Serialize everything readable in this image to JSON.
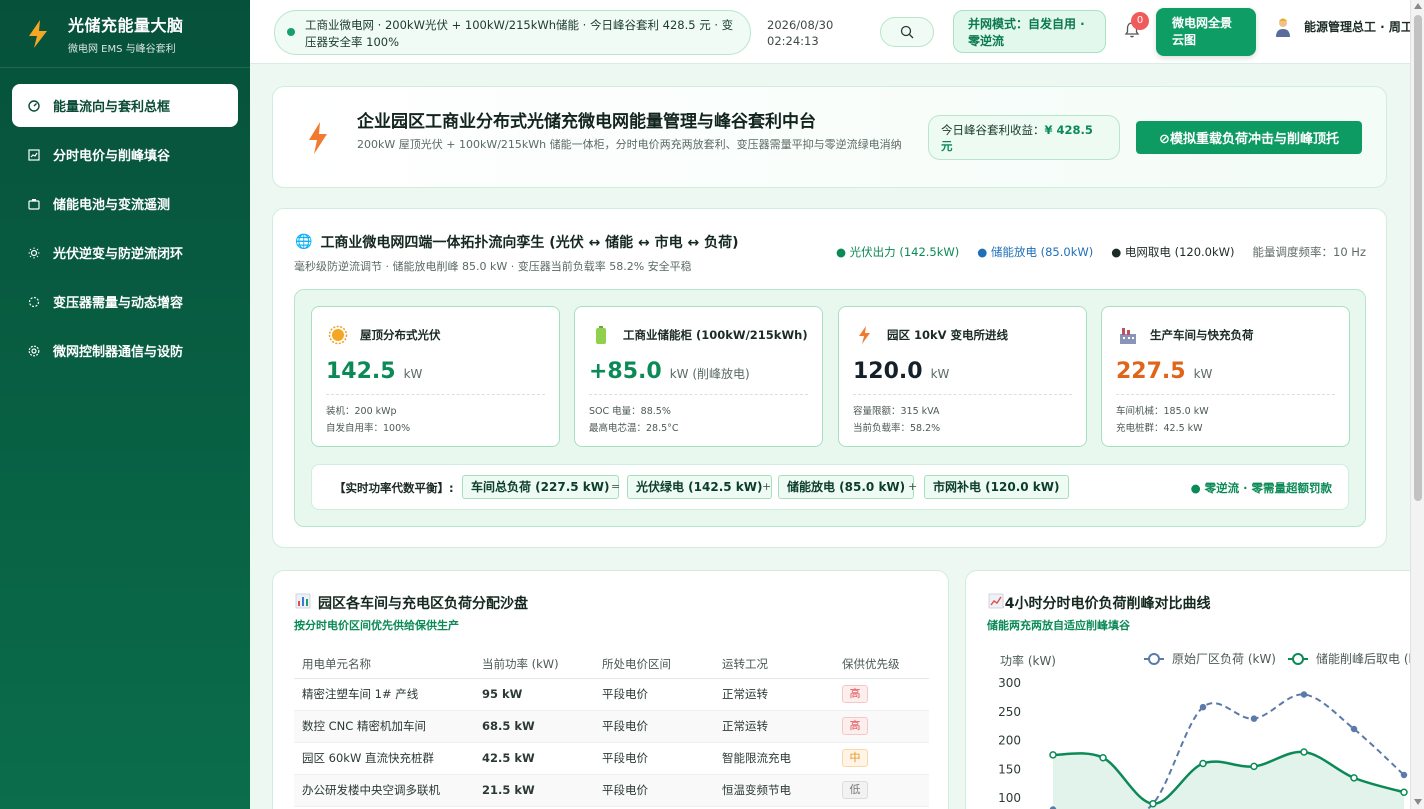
{
  "brand": {
    "title": "光储充能量大脑",
    "subtitle": "微电网 EMS 与峰谷套利"
  },
  "sidebar": {
    "items": [
      {
        "label": "能量流向与套利总框",
        "icon": "dashboard-icon",
        "active": true
      },
      {
        "label": "分时电价与削峰填谷",
        "icon": "chart-icon",
        "active": false
      },
      {
        "label": "储能电池与变流遥测",
        "icon": "battery-icon",
        "active": false
      },
      {
        "label": "光伏逆变与防逆流闭环",
        "icon": "sun-icon",
        "active": false
      },
      {
        "label": "变压器需量与动态增容",
        "icon": "transformer-icon",
        "active": false
      },
      {
        "label": "微网控制器通信与设防",
        "icon": "gear-icon",
        "active": false
      }
    ]
  },
  "topbar": {
    "ticker": "工商业微电网 · 200kW光伏 + 100kW/215kWh储能 · 今日峰谷套利 428.5 元 · 变压器安全率 100%",
    "date": "2026/08/30",
    "time": "02:24:13",
    "grid_mode": "并网模式：自发自用 · 零逆流",
    "notification_count": "0",
    "cloud_button": "微电网全景云图",
    "user": "能源管理总工 · 周工"
  },
  "hero": {
    "title": "企业园区工商业分布式光储充微电网能量管理与峰谷套利中台",
    "desc": "200kW 屋顶光伏 + 100kW/215kWh 储能一体柜，分时电价两充两放套利、变压器需量平抑与零逆流绿电消纳",
    "earn_label": "今日峰谷套利收益：",
    "earn_value": "¥ 428.5 元",
    "sim_button": "⊘模拟重载负荷冲击与削峰顶托"
  },
  "topology": {
    "title": "工商业微电网四端一体拓扑流向孪生 (光伏 ↔ 储能 ↔ 市电 ↔ 负荷)",
    "subtitle": "毫秒级防逆流调节 · 储能放电削峰 85.0 kW · 变压器当前负载率 58.2% 安全平稳",
    "legend": {
      "pv": "● 光伏出力 (142.5kW)",
      "storage": "● 储能放电 (85.0kW)",
      "grid": "● 电网取电 (120.0kW)",
      "freq": "能量调度频率：10 Hz"
    },
    "nodes": [
      {
        "title": "屋顶分布式光伏",
        "value": "142.5",
        "unit": "kW",
        "color": "#0b8a57",
        "meta1": "装机：200 kWp",
        "meta2": "自发自用率：100%"
      },
      {
        "title": "工商业储能柜 (100kW/215kWh)",
        "value": "+85.0",
        "unit": "kW (削峰放电)",
        "color": "#0b8a57",
        "meta1": "SOC 电量：88.5%",
        "meta2": "最高电芯温：28.5°C"
      },
      {
        "title": "园区 10kV 变电所进线",
        "value": "120.0",
        "unit": "kW",
        "color": "#14202a",
        "meta1": "容量限额：315 kVA",
        "meta2": "当前负载率：58.2%"
      },
      {
        "title": "生产车间与快充负荷",
        "value": "227.5",
        "unit": "kW",
        "color": "#e0641a",
        "meta1": "车间机械：185.0 kW",
        "meta2": "充电桩群：42.5 kW"
      }
    ],
    "balance": {
      "label": "【实时功率代数平衡】:",
      "load": "车间总负荷 (227.5 kW)",
      "eq": "=",
      "pv": "光伏绿电 (142.5 kW)",
      "plus1": "+",
      "storage": "储能放电 (85.0 kW)",
      "plus2": "+",
      "grid": "市网补电 (120.0 kW)",
      "note": "● 零逆流 · 零需量超额罚款"
    }
  },
  "load_section": {
    "title": "园区各车间与充电区负荷分配沙盘",
    "subtitle": "按分时电价区间优先供给保供生产",
    "headers": [
      "用电单元名称",
      "当前功率 (kW)",
      "所处电价区间",
      "运转工况",
      "保供优先级"
    ],
    "rows": [
      {
        "name": "精密注塑车间 1# 产线",
        "power": "95 kW",
        "tariff": "平段电价",
        "status": "正常运转",
        "priority": "高",
        "level": "high"
      },
      {
        "name": "数控 CNC 精密机加车间",
        "power": "68.5 kW",
        "tariff": "平段电价",
        "status": "正常运转",
        "priority": "高",
        "level": "high"
      },
      {
        "name": "园区 60kW 直流快充桩群",
        "power": "42.5 kW",
        "tariff": "平段电价",
        "status": "智能限流充电",
        "priority": "中",
        "level": "mid"
      },
      {
        "name": "办公研发楼中央空调多联机",
        "power": "21.5 kW",
        "tariff": "平段电价",
        "status": "恒温变频节电",
        "priority": "低",
        "level": "low"
      }
    ]
  },
  "curve_section": {
    "title": "24小时分时电价负荷削峰对比曲线",
    "subtitle": "储能两充两放自适应削峰填谷"
  },
  "chart_data": {
    "type": "line",
    "ylabel": "功率 (kW)",
    "yticks": [
      100,
      150,
      200,
      250,
      300
    ],
    "series": [
      {
        "name": "原始厂区负荷 (kW)",
        "color": "#5b7aa8",
        "style": "dashed",
        "values": [
          80,
          60,
          90,
          258,
          238,
          280,
          220,
          140
        ]
      },
      {
        "name": "储能削峰后取电 (k",
        "color": "#0b8a57",
        "style": "solid",
        "values": [
          175,
          170,
          90,
          160,
          155,
          180,
          135,
          110
        ]
      }
    ]
  },
  "colors": {
    "brand": "#0b6b48",
    "accent": "#0f9d66",
    "warn": "#e0641a"
  }
}
